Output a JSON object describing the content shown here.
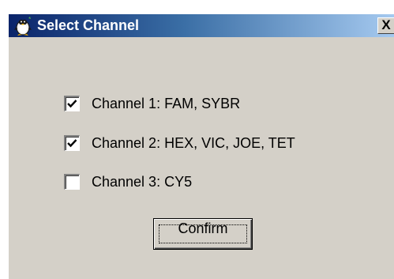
{
  "window": {
    "title": "Select Channel",
    "close_label": "X",
    "app_icon": "penguin-app-icon",
    "titlebar_color_start": "#0a246a",
    "titlebar_color_end": "#a6caf0",
    "face_color": "#d4d0c8"
  },
  "channels": [
    {
      "label": "Channel 1: FAM, SYBR",
      "checked": true
    },
    {
      "label": "Channel 2: HEX, VIC, JOE, TET",
      "checked": true
    },
    {
      "label": "Channel 3: CY5",
      "checked": false
    }
  ],
  "confirm_label": "Confirm"
}
